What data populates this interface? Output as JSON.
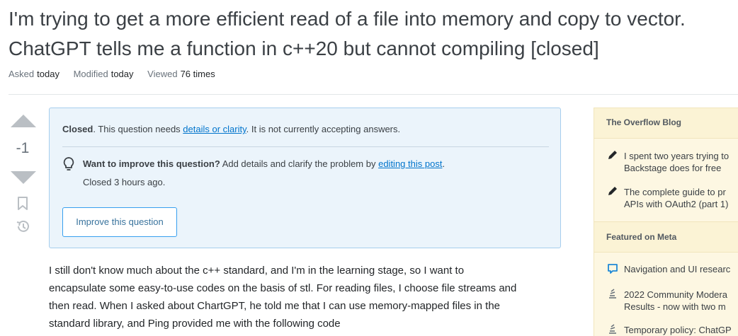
{
  "question": {
    "title_line1": "I'm trying to get a more efficient read of a file into memory and copy to vector.",
    "title_line2": "ChatGPT tells me a function in c++20 but cannot compiling [closed]",
    "asked_label": "Asked",
    "asked_value": "today",
    "modified_label": "Modified",
    "modified_value": "today",
    "viewed_label": "Viewed",
    "viewed_value": "76 times",
    "vote_count": "-1"
  },
  "notice": {
    "closed_bold": "Closed",
    "closed_text1": ". This question needs ",
    "closed_link": "details or clarity",
    "closed_text2": ". It is not currently accepting answers.",
    "improve_bold": "Want to improve this question?",
    "improve_text1": " Add details and clarify the problem by ",
    "improve_link": "editing this post",
    "improve_text2": ".",
    "closed_ago": "Closed 3 hours ago.",
    "improve_button": "Improve this question"
  },
  "body": {
    "line1": "I still don't know much about the c++ standard, and I'm in the learning stage, so I want to",
    "line2": "encapsulate some easy-to-use codes on the basis of stl. For reading files, I choose file streams and",
    "line3": "then read. When I asked about ChartGPT, he told me that I can use memory-mapped files in the",
    "line4": "standard library, and Ping provided me with the following code"
  },
  "sidebar": {
    "blog_header": "The Overflow Blog",
    "blog_items": [
      {
        "line1": "I spent two years trying to",
        "line2": "Backstage does for free"
      },
      {
        "line1": "The complete guide to pr",
        "line2": "APIs with OAuth2 (part 1)"
      }
    ],
    "meta_header": "Featured on Meta",
    "meta_items": [
      {
        "line1": "Navigation and UI researc",
        "line2": ""
      },
      {
        "line1": "2022 Community Modera",
        "line2": "Results - now with two m"
      },
      {
        "line1": "Temporary policy: ChatGP",
        "line2": ""
      }
    ]
  },
  "colors": {
    "link": "#0074cc",
    "notice_bg": "#ebf4fb",
    "sidebar_bg": "#fdf7e2",
    "vote_arrow": "#babfc4"
  }
}
